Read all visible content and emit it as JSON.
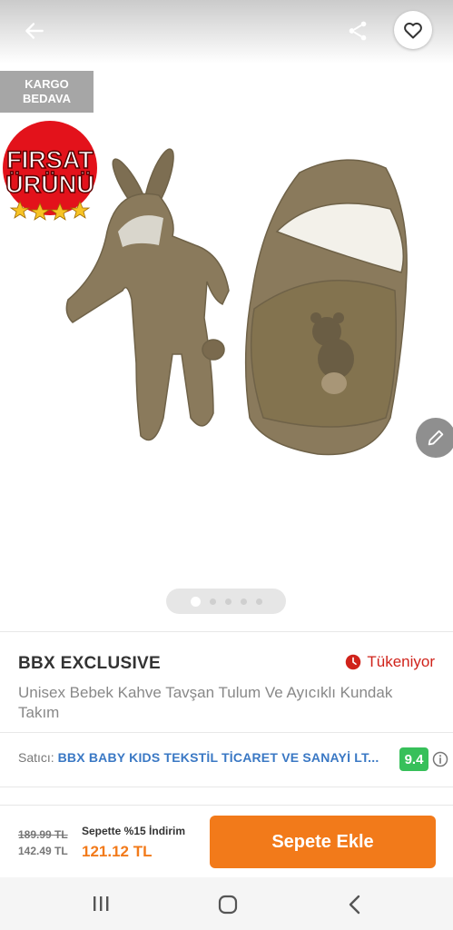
{
  "badges": {
    "kargo_line1": "KARGO",
    "kargo_line2": "BEDAVA",
    "firsat_line1": "FIRSAT",
    "firsat_line2": "ÜRÜNÜ"
  },
  "gallery": {
    "image_count": 5,
    "active_index": 0
  },
  "product": {
    "brand": "BBX EXCLUSIVE",
    "stock_status": "Tükeniyor",
    "title": "Unisex Bebek Kahve Tavşan Tulum Ve Ayıcıklı Kundak Takım"
  },
  "seller": {
    "label": "Satıcı:",
    "name": "BBX BABY KIDS TEKSTİL TİCARET VE SANAYİ LT...",
    "rating": "9.4"
  },
  "pricing": {
    "original": "189.99 TL",
    "discounted": "142.49 TL",
    "promo_text": "Sepette %15 İndirim",
    "basket_price": "121.12 TL"
  },
  "cta": {
    "add_to_cart": "Sepete Ekle"
  },
  "colors": {
    "accent_orange": "#f27a1a",
    "stock_red": "#d0231b",
    "rating_green": "#37c05a",
    "seller_blue": "#3a78c4"
  },
  "icons": {
    "back": "arrow-left-icon",
    "share": "share-icon",
    "favorite": "heart-outline-icon",
    "edit": "pencil-icon",
    "stock": "clock-icon",
    "info": "info-icon"
  }
}
